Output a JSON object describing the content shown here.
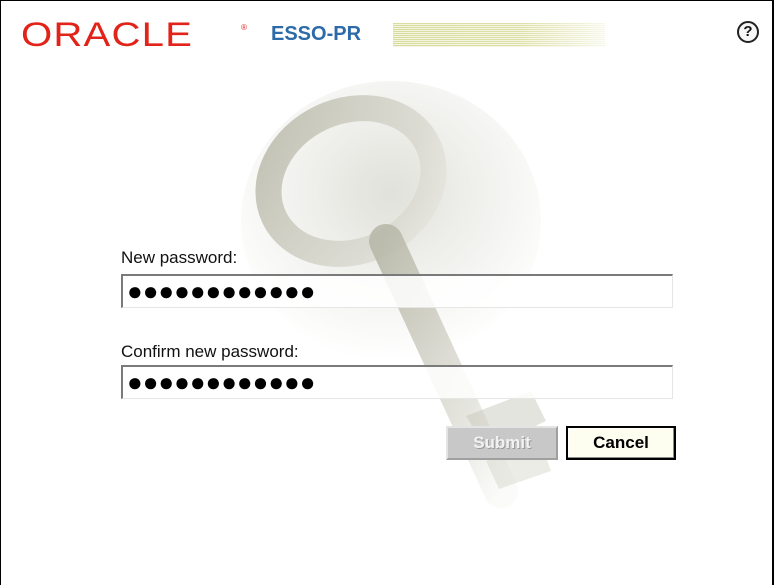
{
  "header": {
    "logo_text": "ORACLE",
    "logo_mark": "®",
    "product_name": "ESSO-PR",
    "help_label": "?"
  },
  "form": {
    "new_password_label": "New password:",
    "new_password_value": "●●●●●●●●●●●●",
    "confirm_password_label": "Confirm new password:",
    "confirm_password_value": "●●●●●●●●●●●●"
  },
  "actions": {
    "submit_label": "Submit",
    "submit_enabled": false,
    "cancel_label": "Cancel"
  },
  "colors": {
    "brand_red": "#e2231a",
    "product_blue": "#2d6aa8"
  },
  "icons": {
    "help": "help-icon",
    "watermark": "key-icon"
  }
}
